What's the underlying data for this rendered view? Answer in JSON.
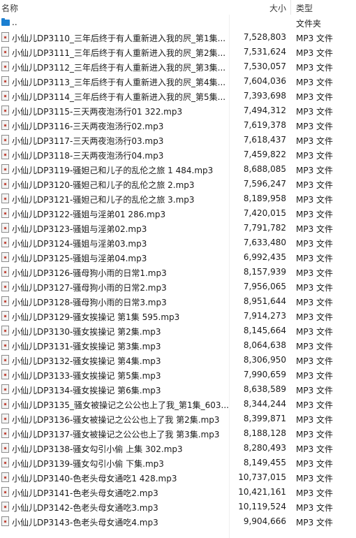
{
  "columns": {
    "name": "名称",
    "size": "大小",
    "type": "类型"
  },
  "up_row": {
    "name": "..",
    "size": "",
    "type": "文件夹",
    "icon": "folder-up-icon"
  },
  "files": [
    {
      "name": "小仙儿DP3110_三年后终于有人重新进入我的屄_第1集...",
      "size": "7,528,803",
      "type": "MP3 文件"
    },
    {
      "name": "小仙儿DP3111_三年后终于有人重新进入我的屄_第2集...",
      "size": "7,531,624",
      "type": "MP3 文件"
    },
    {
      "name": "小仙儿DP3112_三年后终于有人重新进入我的屄_第3集...",
      "size": "7,530,057",
      "type": "MP3 文件"
    },
    {
      "name": "小仙儿DP3113_三年后终于有人重新进入我的屄_第4集...",
      "size": "7,604,036",
      "type": "MP3 文件"
    },
    {
      "name": "小仙儿DP3114_三年后终于有人重新进入我的屄_第5集...",
      "size": "7,393,698",
      "type": "MP3 文件"
    },
    {
      "name": "小仙儿DP3115-三天两夜泡汤行01 322.mp3",
      "size": "7,494,312",
      "type": "MP3 文件"
    },
    {
      "name": "小仙儿DP3116-三天两夜泡汤行02.mp3",
      "size": "7,619,378",
      "type": "MP3 文件"
    },
    {
      "name": "小仙儿DP3117-三天两夜泡汤行03.mp3",
      "size": "7,618,437",
      "type": "MP3 文件"
    },
    {
      "name": "小仙儿DP3118-三天两夜泡汤行04.mp3",
      "size": "7,459,822",
      "type": "MP3 文件"
    },
    {
      "name": "小仙儿DP3119-骚妲己和儿子的乱伦之旅 1 484.mp3",
      "size": "8,688,085",
      "type": "MP3 文件"
    },
    {
      "name": "小仙儿DP3120-骚妲己和儿子的乱伦之旅 2.mp3",
      "size": "7,596,247",
      "type": "MP3 文件"
    },
    {
      "name": "小仙儿DP3121-骚妲己和儿子的乱伦之旅 3.mp3",
      "size": "8,189,958",
      "type": "MP3 文件"
    },
    {
      "name": "小仙儿DP3122-骚姐与淫弟01 286.mp3",
      "size": "7,420,015",
      "type": "MP3 文件"
    },
    {
      "name": "小仙儿DP3123-骚姐与淫弟02.mp3",
      "size": "7,791,782",
      "type": "MP3 文件"
    },
    {
      "name": "小仙儿DP3124-骚姐与淫弟03.mp3",
      "size": "7,633,480",
      "type": "MP3 文件"
    },
    {
      "name": "小仙儿DP3125-骚姐与淫弟04.mp3",
      "size": "6,992,435",
      "type": "MP3 文件"
    },
    {
      "name": "小仙儿DP3126-骚母狗小雨的日常1.mp3",
      "size": "8,157,939",
      "type": "MP3 文件"
    },
    {
      "name": "小仙儿DP3127-骚母狗小雨的日常2.mp3",
      "size": "7,956,065",
      "type": "MP3 文件"
    },
    {
      "name": "小仙儿DP3128-骚母狗小雨的日常3.mp3",
      "size": "8,951,644",
      "type": "MP3 文件"
    },
    {
      "name": "小仙儿DP3129-骚女挨操记 第1集 595.mp3",
      "size": "7,914,273",
      "type": "MP3 文件"
    },
    {
      "name": "小仙儿DP3130-骚女挨操记 第2集.mp3",
      "size": "8,145,664",
      "type": "MP3 文件"
    },
    {
      "name": "小仙儿DP3131-骚女挨操记 第3集.mp3",
      "size": "8,064,638",
      "type": "MP3 文件"
    },
    {
      "name": "小仙儿DP3132-骚女挨操记 第4集.mp3",
      "size": "8,306,950",
      "type": "MP3 文件"
    },
    {
      "name": "小仙儿DP3133-骚女挨操记 第5集.mp3",
      "size": "7,990,659",
      "type": "MP3 文件"
    },
    {
      "name": "小仙儿DP3134-骚女挨操记 第6集.mp3",
      "size": "8,638,589",
      "type": "MP3 文件"
    },
    {
      "name": "小仙儿DP3135_骚女被操记之公公也上了我_第1集_603....",
      "size": "8,344,244",
      "type": "MP3 文件"
    },
    {
      "name": "小仙儿DP3136-骚女被操记之公公也上了我 第2集.mp3",
      "size": "8,399,871",
      "type": "MP3 文件"
    },
    {
      "name": "小仙儿DP3137-骚女被操记之公公也上了我 第3集.mp3",
      "size": "8,188,128",
      "type": "MP3 文件"
    },
    {
      "name": "小仙儿DP3138-骚女勾引小偷 上集 302.mp3",
      "size": "8,280,493",
      "type": "MP3 文件"
    },
    {
      "name": "小仙儿DP3139-骚女勾引小偷 下集.mp3",
      "size": "8,149,455",
      "type": "MP3 文件"
    },
    {
      "name": "小仙儿DP3140-色老头母女通吃1 428.mp3",
      "size": "10,737,015",
      "type": "MP3 文件"
    },
    {
      "name": "小仙儿DP3141-色老头母女通吃2.mp3",
      "size": "10,421,161",
      "type": "MP3 文件"
    },
    {
      "name": "小仙儿DP3142-色老头母女通吃3.mp3",
      "size": "10,119,524",
      "type": "MP3 文件"
    },
    {
      "name": "小仙儿DP3143-色老头母女通吃4.mp3",
      "size": "9,904,666",
      "type": "MP3 文件"
    }
  ]
}
